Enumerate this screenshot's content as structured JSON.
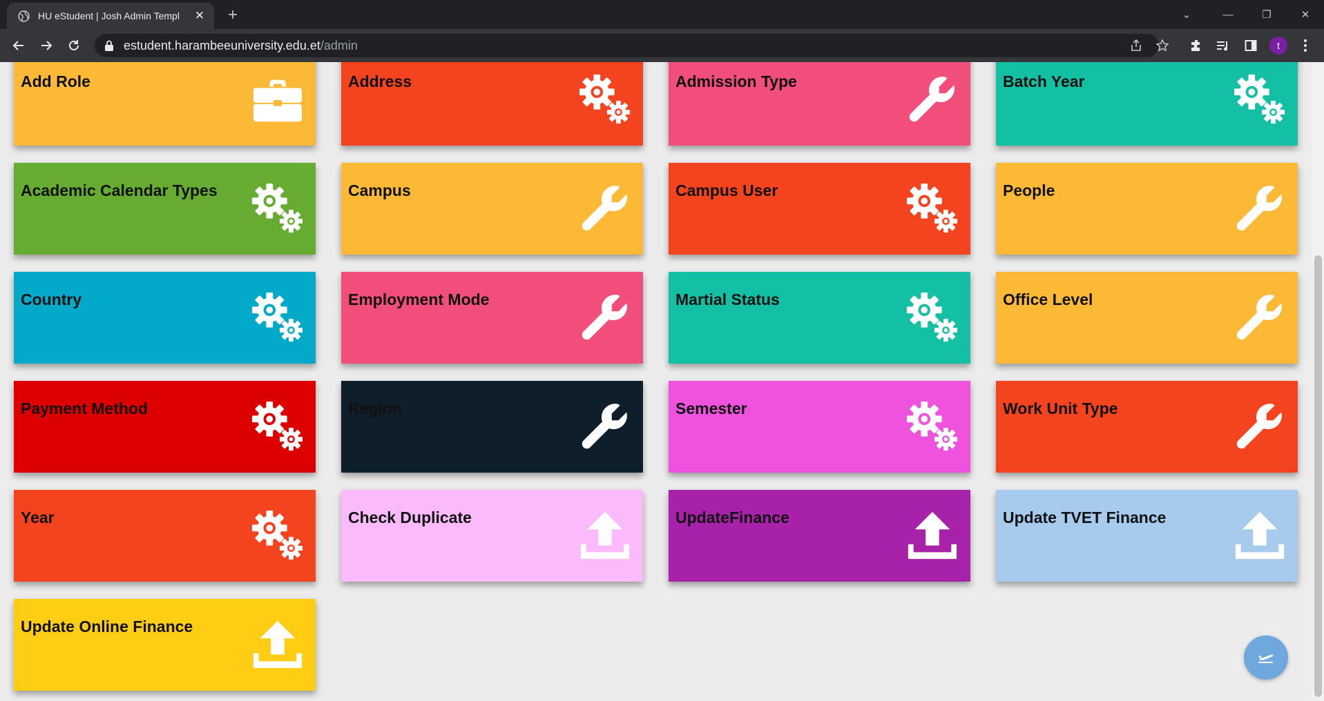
{
  "browser": {
    "tab_title": "HU eStudent | Josh Admin Templ",
    "url_host": "estudent.harambeeuniversity.edu.et",
    "url_path": "/admin",
    "profile_initial": "t"
  },
  "colors": {
    "orange": "#fbb936",
    "red_orange": "#f4431f",
    "pink": "#f14e7b",
    "teal": "#14c0a3",
    "green": "#66ab32",
    "cyan": "#03a9c8",
    "red": "#dd0000",
    "navy": "#0f1e2b",
    "magenta": "#ef53dd",
    "light_pink": "#fbbafb",
    "purple": "#a821a9",
    "light_blue": "#a7cbed",
    "yellow": "#fecd14",
    "fab": "#6fa8dc"
  },
  "cards": [
    {
      "label": "Add Role",
      "color": "#fbb936",
      "icon": "briefcase-icon"
    },
    {
      "label": "Address",
      "color": "#f4431f",
      "icon": "gears-icon"
    },
    {
      "label": "Admission Type",
      "color": "#f14e7b",
      "icon": "wrench-icon"
    },
    {
      "label": "Batch Year",
      "color": "#14c0a3",
      "icon": "gears-icon"
    },
    {
      "label": "Academic Calendar Types",
      "color": "#66ab32",
      "icon": "gears-icon"
    },
    {
      "label": "Campus",
      "color": "#fbb936",
      "icon": "wrench-icon"
    },
    {
      "label": "Campus User",
      "color": "#f4431f",
      "icon": "gears-icon"
    },
    {
      "label": "People",
      "color": "#fbb936",
      "icon": "wrench-icon"
    },
    {
      "label": "Country",
      "color": "#03a9c8",
      "icon": "gears-icon"
    },
    {
      "label": "Employment Mode",
      "color": "#f14e7b",
      "icon": "wrench-icon"
    },
    {
      "label": "Martial Status",
      "color": "#14c0a3",
      "icon": "gears-icon"
    },
    {
      "label": "Office Level",
      "color": "#fbb936",
      "icon": "wrench-icon"
    },
    {
      "label": "Payment Method",
      "color": "#dd0000",
      "icon": "gears-icon"
    },
    {
      "label": "Region",
      "color": "#0f1e2b",
      "icon": "wrench-icon"
    },
    {
      "label": "Semester",
      "color": "#ef53dd",
      "icon": "gears-icon"
    },
    {
      "label": "Work Unit Type",
      "color": "#f4431f",
      "icon": "wrench-icon"
    },
    {
      "label": "Year",
      "color": "#f4431f",
      "icon": "gears-icon"
    },
    {
      "label": "Check Duplicate",
      "color": "#fbbafb",
      "icon": "upload-icon"
    },
    {
      "label": "UpdateFinance",
      "color": "#a821a9",
      "icon": "upload-icon"
    },
    {
      "label": "Update TVET Finance",
      "color": "#a7cbed",
      "icon": "upload-icon"
    },
    {
      "label": "Update Online Finance",
      "color": "#fecd14",
      "icon": "upload-icon"
    }
  ],
  "fab": {
    "icon": "plane-icon"
  }
}
